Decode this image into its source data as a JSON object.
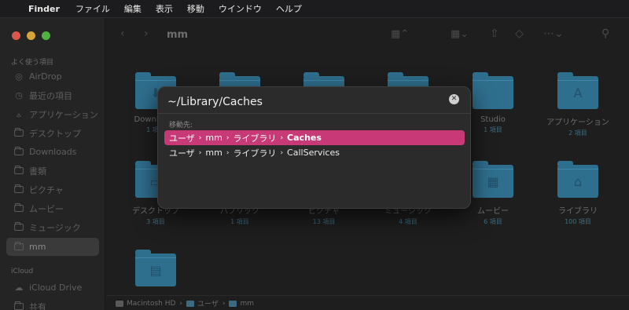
{
  "menubar": {
    "apple": "",
    "items": [
      "Finder",
      "ファイル",
      "編集",
      "表示",
      "移動",
      "ウインドウ",
      "ヘルプ"
    ]
  },
  "window": {
    "title": "mm"
  },
  "sidebar": {
    "favorites_header": "よく使う項目",
    "items": [
      {
        "label": "AirDrop",
        "icon": "airdrop-icon"
      },
      {
        "label": "最近の項目",
        "icon": "clock-icon"
      },
      {
        "label": "アプリケーション",
        "icon": "applications-icon"
      },
      {
        "label": "デスクトップ",
        "icon": "folder-icon"
      },
      {
        "label": "Downloads",
        "icon": "folder-icon"
      },
      {
        "label": "書類",
        "icon": "folder-icon"
      },
      {
        "label": "ピクチャ",
        "icon": "folder-icon"
      },
      {
        "label": "ムービー",
        "icon": "folder-icon"
      },
      {
        "label": "ミュージック",
        "icon": "folder-icon"
      },
      {
        "label": "mm",
        "icon": "folder-icon"
      }
    ],
    "icloud_header": "iCloud",
    "icloud_items": [
      {
        "label": "iCloud Drive",
        "icon": "cloud-icon"
      },
      {
        "label": "共有",
        "icon": "shared-icon"
      }
    ]
  },
  "grid": {
    "row1": [
      {
        "name": "Downloads",
        "count": "1 項目",
        "glyph": "⬇"
      },
      {
        "name": "",
        "count": "",
        "glyph": ""
      },
      {
        "name": "",
        "count": "",
        "glyph": ""
      },
      {
        "name": "",
        "count": "",
        "glyph": ""
      },
      {
        "name": "Studio",
        "count": "1 項目",
        "glyph": ""
      },
      {
        "name": "アプリケーション",
        "count": "2 項目",
        "glyph": "A"
      }
    ],
    "row2": [
      {
        "name": "デスクトップ",
        "count": "3 項目",
        "glyph": "▭"
      },
      {
        "name": "パブリック",
        "count": "1 項目",
        "glyph": ""
      },
      {
        "name": "ピクチャ",
        "count": "13 項目",
        "glyph": ""
      },
      {
        "name": "ミュージック",
        "count": "4 項目",
        "glyph": "♪"
      },
      {
        "name": "ムービー",
        "count": "6 項目",
        "glyph": "▦"
      },
      {
        "name": "ライブラリ",
        "count": "100 項目",
        "glyph": "⌂"
      }
    ],
    "row3": [
      {
        "name": "",
        "count": "",
        "glyph": "▤"
      }
    ]
  },
  "pathbar": {
    "parts": [
      "Macintosh HD",
      "ユーザ",
      "mm"
    ]
  },
  "goto_dialog": {
    "input_value": "~/Library/Caches",
    "section_label": "移動先:",
    "suggestions": [
      {
        "parts": [
          "ユーザ",
          "mm",
          "ライブラリ"
        ],
        "last": "Caches",
        "selected": true
      },
      {
        "parts": [
          "ユーザ",
          "mm",
          "ライブラリ"
        ],
        "last": "CallServices",
        "selected": false
      }
    ],
    "accent": "#c83a77"
  }
}
